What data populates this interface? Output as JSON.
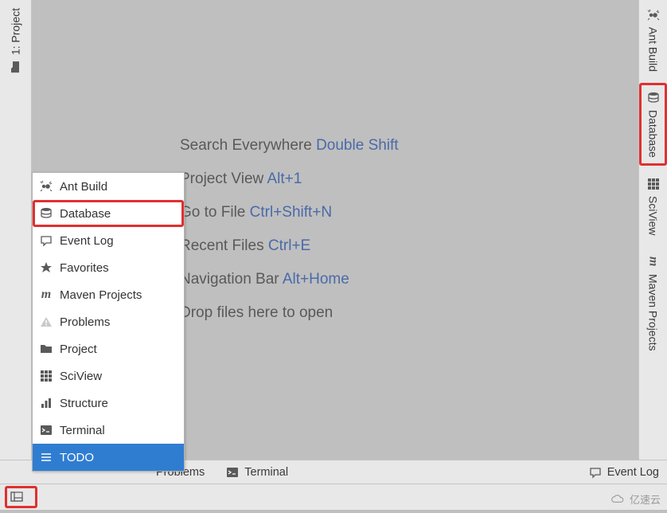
{
  "left_rail": {
    "items": [
      {
        "label": "1: Project",
        "icon": "folder-icon"
      }
    ]
  },
  "right_rail": {
    "items": [
      {
        "label": "Ant Build",
        "icon": "ant-icon",
        "highlighted": false
      },
      {
        "label": "Database",
        "icon": "database-icon",
        "highlighted": true
      },
      {
        "label": "SciView",
        "icon": "sciview-icon",
        "highlighted": false
      },
      {
        "label": "Maven Projects",
        "icon": "maven-icon",
        "highlighted": false
      }
    ]
  },
  "tips": [
    {
      "label": "Search Everywhere",
      "key": "Double Shift"
    },
    {
      "label": "Project View",
      "key": "Alt+1"
    },
    {
      "label": "Go to File",
      "key": "Ctrl+Shift+N"
    },
    {
      "label": "Recent Files",
      "key": "Ctrl+E"
    },
    {
      "label": "Navigation Bar",
      "key": "Alt+Home"
    },
    {
      "label": "Drop files here to open",
      "key": ""
    }
  ],
  "popup": {
    "items": [
      {
        "label": "Ant Build",
        "icon": "ant-icon",
        "highlighted": false,
        "selected": false
      },
      {
        "label": "Database",
        "icon": "database-icon",
        "highlighted": true,
        "selected": false
      },
      {
        "label": "Event Log",
        "icon": "bubble-icon",
        "highlighted": false,
        "selected": false
      },
      {
        "label": "Favorites",
        "icon": "star-icon",
        "highlighted": false,
        "selected": false
      },
      {
        "label": "Maven Projects",
        "icon": "maven-icon",
        "highlighted": false,
        "selected": false
      },
      {
        "label": "Problems",
        "icon": "warning-icon",
        "highlighted": false,
        "selected": false
      },
      {
        "label": "Project",
        "icon": "folder-icon",
        "highlighted": false,
        "selected": false
      },
      {
        "label": "SciView",
        "icon": "sciview-icon",
        "highlighted": false,
        "selected": false
      },
      {
        "label": "Structure",
        "icon": "structure-icon",
        "highlighted": false,
        "selected": false
      },
      {
        "label": "Terminal",
        "icon": "terminal-icon",
        "highlighted": false,
        "selected": false
      },
      {
        "label": "TODO",
        "icon": "todo-icon",
        "highlighted": false,
        "selected": true
      }
    ]
  },
  "bottom_bar": {
    "items_left": [
      {
        "label": "Problems",
        "icon": ""
      },
      {
        "label": "Terminal",
        "icon": "terminal-icon"
      }
    ],
    "items_right": [
      {
        "label": "Event Log",
        "icon": "bubble-icon"
      }
    ]
  },
  "status_bar": {
    "corner_highlighted": true
  },
  "watermark": "亿速云"
}
